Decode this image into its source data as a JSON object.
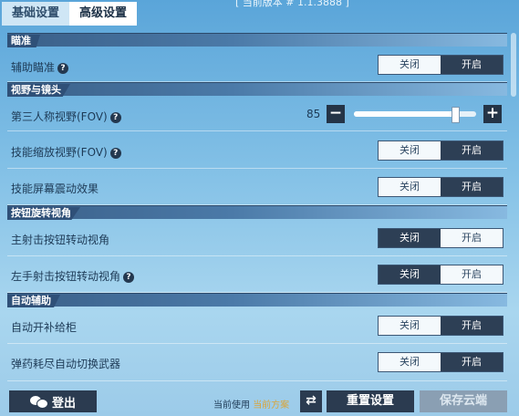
{
  "tabs": [
    {
      "label": "基础设置",
      "active": false
    },
    {
      "label": "高级设置",
      "active": true
    }
  ],
  "top_note": "[ 当前版本 # 1.1.3888 ]",
  "sections": {
    "aim": "瞄准",
    "view": "视野与镜头",
    "button_turn": "按钮旋转视角",
    "auto_assist": "自动辅助"
  },
  "settings": {
    "aim_assist": {
      "label": "辅助瞄准",
      "off": "关闭",
      "on": "开启",
      "selected": "on",
      "has_help": true
    },
    "third_person_fov": {
      "label": "第三人称视野(FOV)",
      "value": "85",
      "minus": "−",
      "plus": "+",
      "slider_fraction": 0.83,
      "has_help": true
    },
    "skill_zoom_fov": {
      "label": "技能缩放视野(FOV)",
      "off": "关闭",
      "on": "开启",
      "selected": "on",
      "has_help": true
    },
    "skill_screen_shake": {
      "label": "技能屏幕震动效果",
      "off": "关闭",
      "on": "开启",
      "selected": "on"
    },
    "main_fire_turn": {
      "label": "主射击按钮转动视角",
      "off": "关闭",
      "on": "开启",
      "selected": "off"
    },
    "left_fire_turn": {
      "label": "左手射击按钮转动视角",
      "off": "关闭",
      "on": "开启",
      "selected": "off",
      "has_help": true
    },
    "auto_open_supply": {
      "label": "自动开补给柜",
      "off": "关闭",
      "on": "开启",
      "selected": "on"
    },
    "auto_switch_weapon": {
      "label": "弹药耗尽自动切换武器",
      "off": "关闭",
      "on": "开启",
      "selected": "on"
    }
  },
  "bottom": {
    "logout": "登出",
    "current_scheme_prefix": "当前使用",
    "current_scheme_name": "当前方案",
    "reset": "重置设置",
    "save_cloud": "保存云端",
    "swap_glyph": "⇄"
  },
  "colors": {
    "selected_option": "#2d3f55",
    "unselected_option": "#f4f9fc",
    "section_header": "#2f5078",
    "scheme_name": "#d9a53a"
  }
}
